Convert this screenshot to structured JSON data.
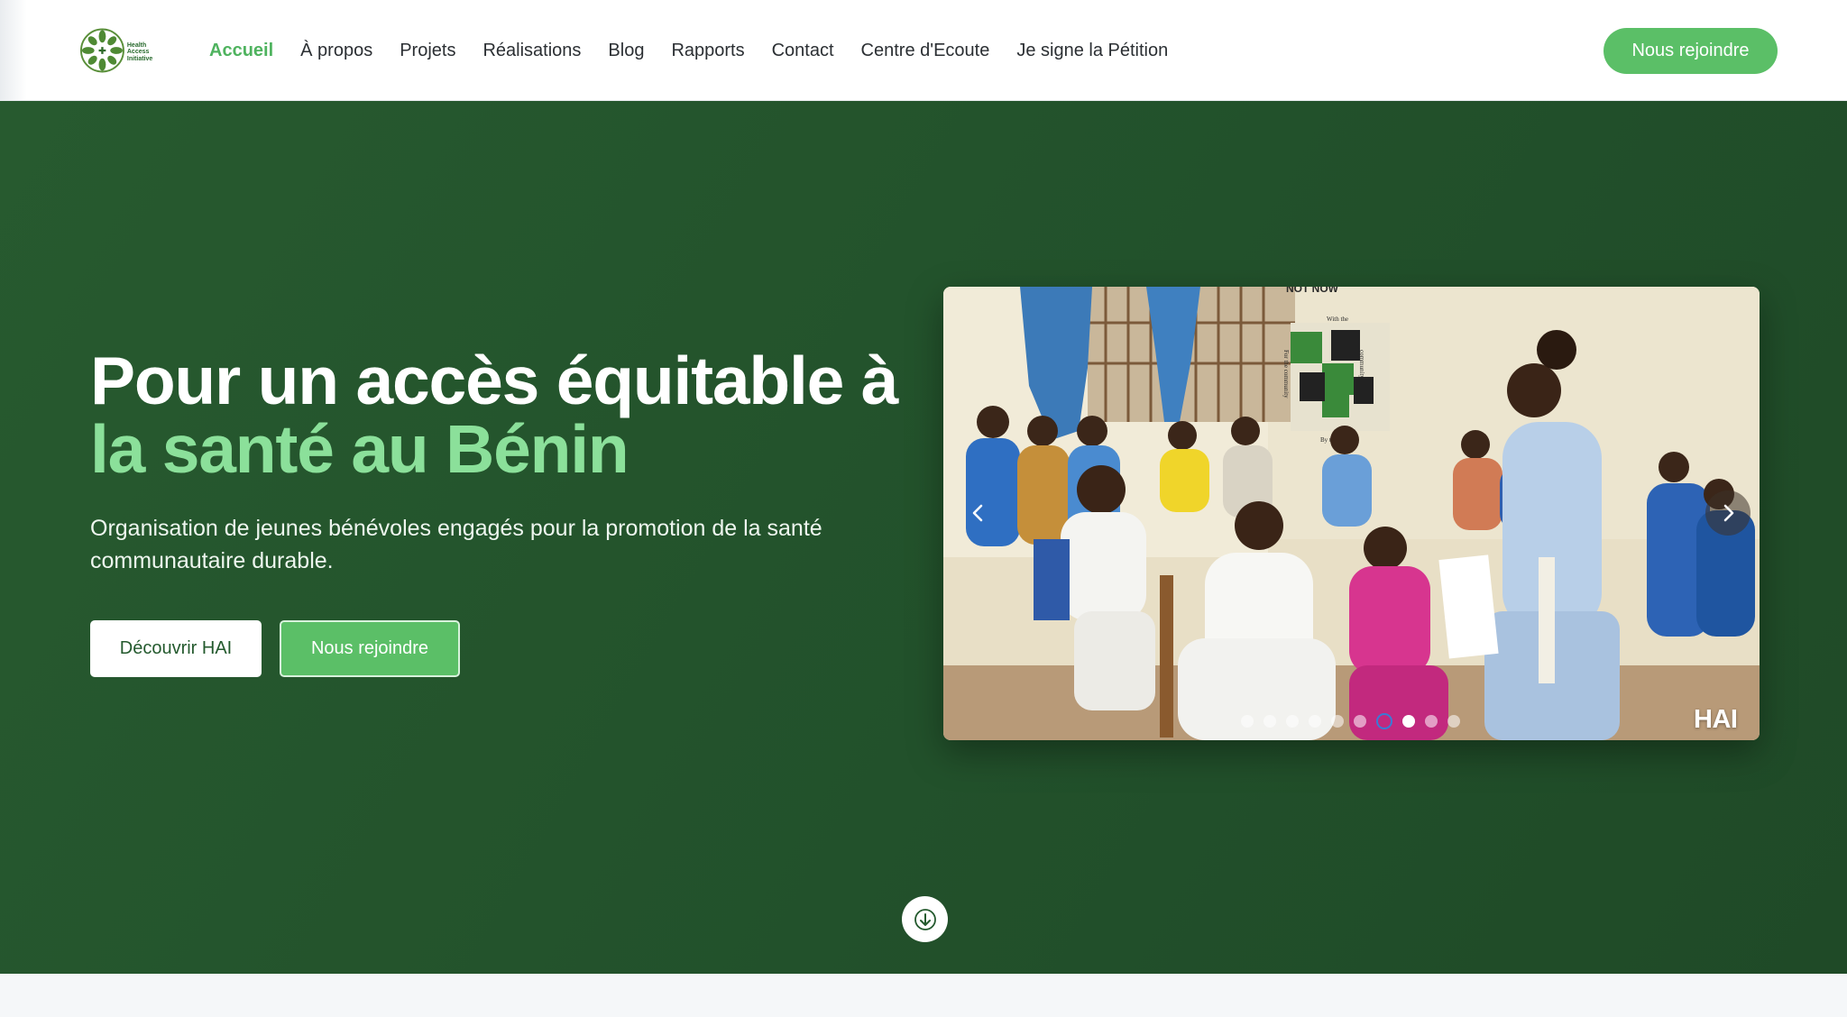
{
  "colors": {
    "brand_green": "#5bbf67",
    "hero_bg": "#22512b",
    "accent_light_green": "#8be09a",
    "active_nav": "#4fb35f"
  },
  "logo": {
    "text": "Health Access Initiative",
    "icon": "hai-leaf-logo-icon"
  },
  "nav": {
    "items": [
      {
        "label": "Accueil",
        "active": true
      },
      {
        "label": "À propos"
      },
      {
        "label": "Projets"
      },
      {
        "label": "Réalisations"
      },
      {
        "label": "Blog"
      },
      {
        "label": "Rapports"
      },
      {
        "label": "Contact"
      },
      {
        "label": "Centre d'Ecoute"
      },
      {
        "label": "Je signe la Pétition"
      }
    ],
    "cta_label": "Nous rejoindre"
  },
  "hero": {
    "title_line1": "Pour un accès équitable à",
    "title_line2": "la santé au Bénin",
    "subtitle": "Organisation de jeunes bénévoles engagés pour la promotion de la santé communautaire durable.",
    "primary_button": "Découvrir HAI",
    "secondary_button": "Nous rejoindre"
  },
  "carousel": {
    "watermark": "HAI",
    "slide_count": 10,
    "current_slide": 7,
    "prev_icon": "chevron-left-icon",
    "next_icon": "chevron-right-icon",
    "wall_texts": [
      "NOT NOW",
      "With the",
      "community",
      "By the com",
      "For the community"
    ]
  },
  "scroll_icon": "arrow-down-icon"
}
